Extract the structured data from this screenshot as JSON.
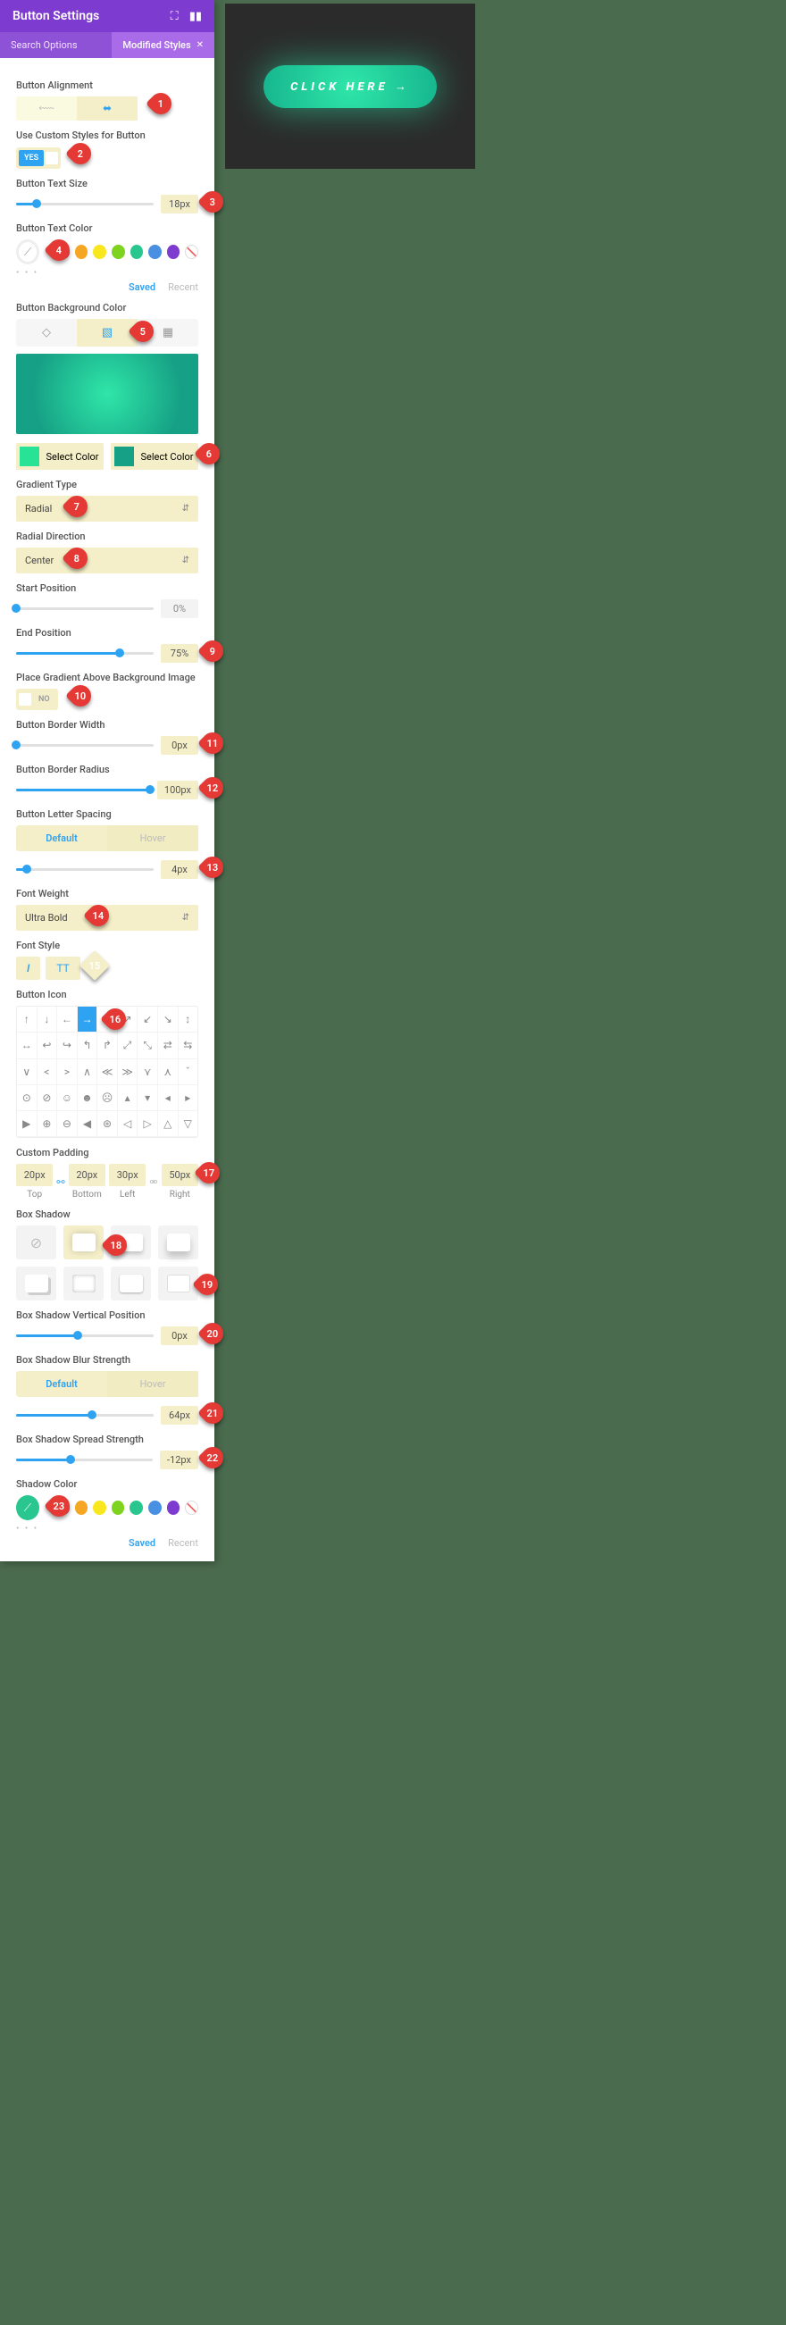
{
  "header": {
    "title": "Button Settings"
  },
  "tabs": {
    "search": "Search Options",
    "modified": "Modified Styles"
  },
  "labels": {
    "alignment": "Button Alignment",
    "custom_styles": "Use Custom Styles for Button",
    "text_size": "Button Text Size",
    "text_color": "Button Text Color",
    "bg_color": "Button Background Color",
    "grad_type": "Gradient Type",
    "radial_dir": "Radial Direction",
    "start_pos": "Start Position",
    "end_pos": "End Position",
    "place_grad": "Place Gradient Above Background Image",
    "border_w": "Button Border Width",
    "border_r": "Button Border Radius",
    "letter_sp": "Button Letter Spacing",
    "font_w": "Font Weight",
    "font_s": "Font Style",
    "icon": "Button Icon",
    "padding": "Custom Padding",
    "box_shadow": "Box Shadow",
    "bs_vert": "Box Shadow Vertical Position",
    "bs_blur": "Box Shadow Blur Strength",
    "bs_spread": "Box Shadow Spread Strength",
    "shadow_col": "Shadow Color"
  },
  "toggles": {
    "yes": "YES",
    "no": "NO"
  },
  "values": {
    "text_size": "18px",
    "start_pos": "0%",
    "end_pos": "75%",
    "border_w": "0px",
    "border_r": "100px",
    "letter_sp": "4px",
    "bs_vert": "0px",
    "bs_blur": "64px",
    "bs_spread": "-12px"
  },
  "selects": {
    "grad_type": "Radial",
    "radial_dir": "Center",
    "font_w": "Ultra Bold",
    "select_color": "Select Color"
  },
  "defhov": {
    "default": "Default",
    "hover": "Hover"
  },
  "fontstyle": {
    "italic": "I",
    "caps": "TT"
  },
  "padding": {
    "top": {
      "v": "20px",
      "l": "Top"
    },
    "bottom": {
      "v": "20px",
      "l": "Bottom"
    },
    "left": {
      "v": "30px",
      "l": "Left"
    },
    "right": {
      "v": "50px",
      "l": "Right"
    }
  },
  "saved_recent": {
    "saved": "Saved",
    "recent": "Recent"
  },
  "swatches": [
    "#e53935",
    "#f5a623",
    "#f8e71c",
    "#7ed321",
    "#29c78f",
    "#4a90e2",
    "#7e3bcf"
  ],
  "grad_colors": [
    "#28e396",
    "#16a085"
  ],
  "preview": {
    "text": "CLICK HERE →"
  },
  "markers": [
    "1",
    "2",
    "3",
    "4",
    "5",
    "6",
    "7",
    "8",
    "9",
    "10",
    "11",
    "12",
    "13",
    "14",
    "15",
    "16",
    "17",
    "18",
    "19",
    "20",
    "21",
    "22",
    "23"
  ],
  "bg_tabs_icons": {
    "color": "⬤",
    "gradient": "▧",
    "image": "▦"
  }
}
